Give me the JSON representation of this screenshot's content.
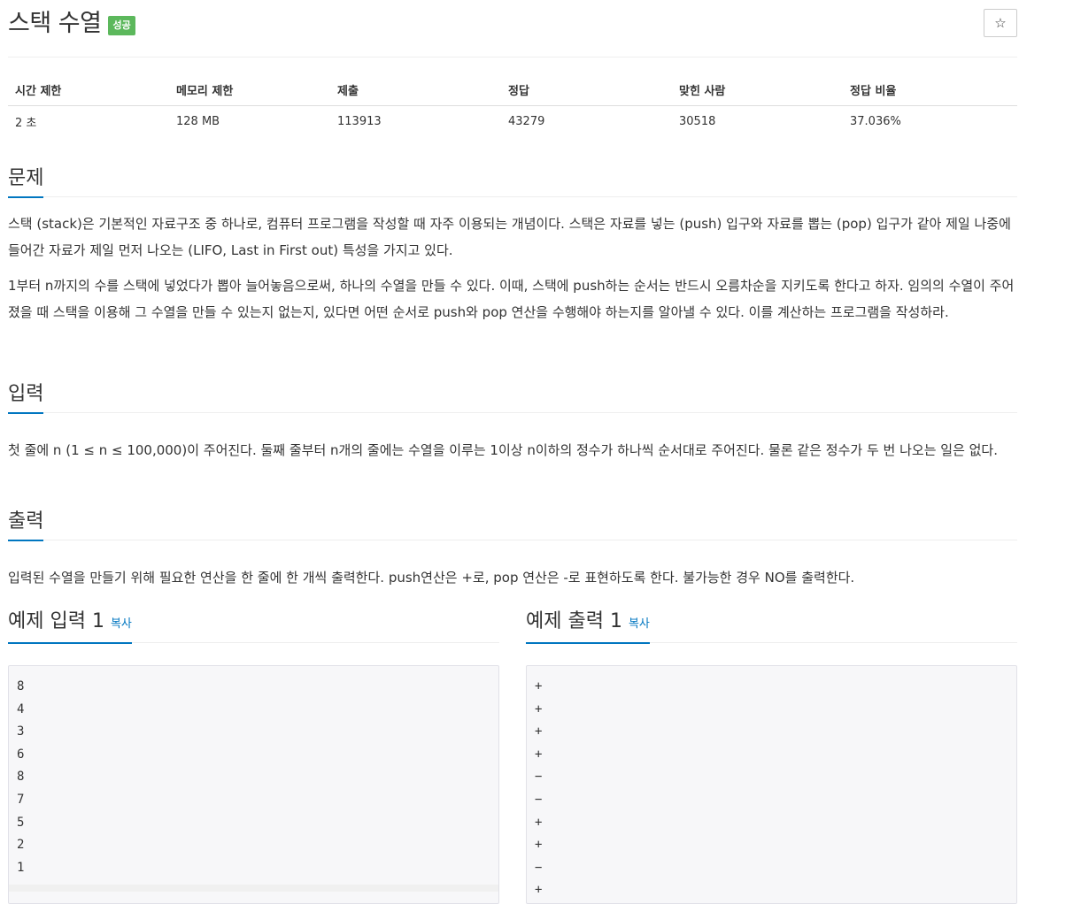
{
  "header": {
    "title": "스택 수열",
    "badge": "성공",
    "star_icon": "☆"
  },
  "info": {
    "headers": [
      "시간 제한",
      "메모리 제한",
      "제출",
      "정답",
      "맞힌 사람",
      "정답 비율"
    ],
    "values": [
      "2 초",
      "128 MB",
      "113913",
      "43279",
      "30518",
      "37.036%"
    ]
  },
  "sections": {
    "problem": {
      "title": "문제",
      "p1": "스택 (stack)은 기본적인 자료구조 중 하나로, 컴퓨터 프로그램을 작성할 때 자주 이용되는 개념이다. 스택은 자료를 넣는 (push) 입구와 자료를 뽑는 (pop) 입구가 같아 제일 나중에 들어간 자료가 제일 먼저 나오는 (LIFO, Last in First out) 특성을 가지고 있다.",
      "p2": "1부터 n까지의 수를 스택에 넣었다가 뽑아 늘어놓음으로써, 하나의 수열을 만들 수 있다. 이때, 스택에 push하는 순서는 반드시 오름차순을 지키도록 한다고 하자. 임의의 수열이 주어졌을 때 스택을 이용해 그 수열을 만들 수 있는지 없는지, 있다면 어떤 순서로 push와 pop 연산을 수행해야 하는지를 알아낼 수 있다. 이를 계산하는 프로그램을 작성하라."
    },
    "input": {
      "title": "입력",
      "p1": "첫 줄에 n (1 ≤ n ≤ 100,000)이 주어진다. 둘째 줄부터 n개의 줄에는 수열을 이루는 1이상 n이하의 정수가 하나씩 순서대로 주어진다. 물론 같은 정수가 두 번 나오는 일은 없다."
    },
    "output": {
      "title": "출력",
      "p1": "입력된 수열을 만들기 위해 필요한 연산을 한 줄에 한 개씩 출력한다. push연산은 +로, pop 연산은 -로 표현하도록 한다. 불가능한 경우 NO를 출력한다."
    },
    "sample_input": {
      "title": "예제 입력 1",
      "copy_label": "복사",
      "lines": [
        "8",
        "4",
        "3",
        "6",
        "8",
        "7",
        "5",
        "2",
        "1"
      ]
    },
    "sample_output": {
      "title": "예제 출력 1",
      "copy_label": "복사",
      "lines": [
        "+",
        "+",
        "+",
        "+",
        "−",
        "−",
        "+",
        "+",
        "−",
        "+"
      ]
    }
  }
}
